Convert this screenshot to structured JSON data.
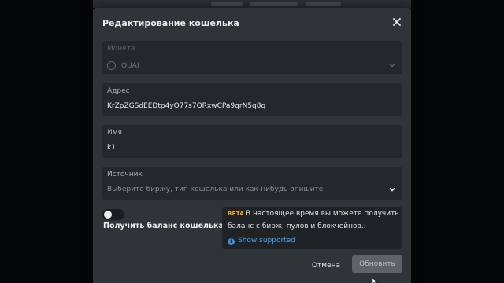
{
  "modal": {
    "title": "Редактирование кошелька",
    "close_icon": "close-icon"
  },
  "fields": {
    "coin": {
      "label": "Монета",
      "value": "QUAI",
      "icon": "coin-circle-icon"
    },
    "address": {
      "label": "Адрес",
      "value": "KrZpZGSdEEDtp4yQ77s7QRxwCPa9qrN5q8q"
    },
    "name": {
      "label": "Имя",
      "value": "k1"
    },
    "source": {
      "label": "Источник",
      "placeholder": "Выберите биржу, тип кошелька или как-нибудь опишите"
    }
  },
  "balance_toggle": {
    "label": "Получить баланс кошелька",
    "enabled": false
  },
  "info": {
    "badge": "BETA",
    "line1": "В настоящее время вы можете получить",
    "line2": "баланс с бирж, пулов и блокчейнов.:",
    "link": "Show supported"
  },
  "buttons": {
    "cancel": "Отмена",
    "update": "Обновить"
  },
  "colors": {
    "modal_bg": "#2f3439",
    "field_bg": "#24282c",
    "beta": "#f5a623",
    "link": "#4aa3ea"
  }
}
